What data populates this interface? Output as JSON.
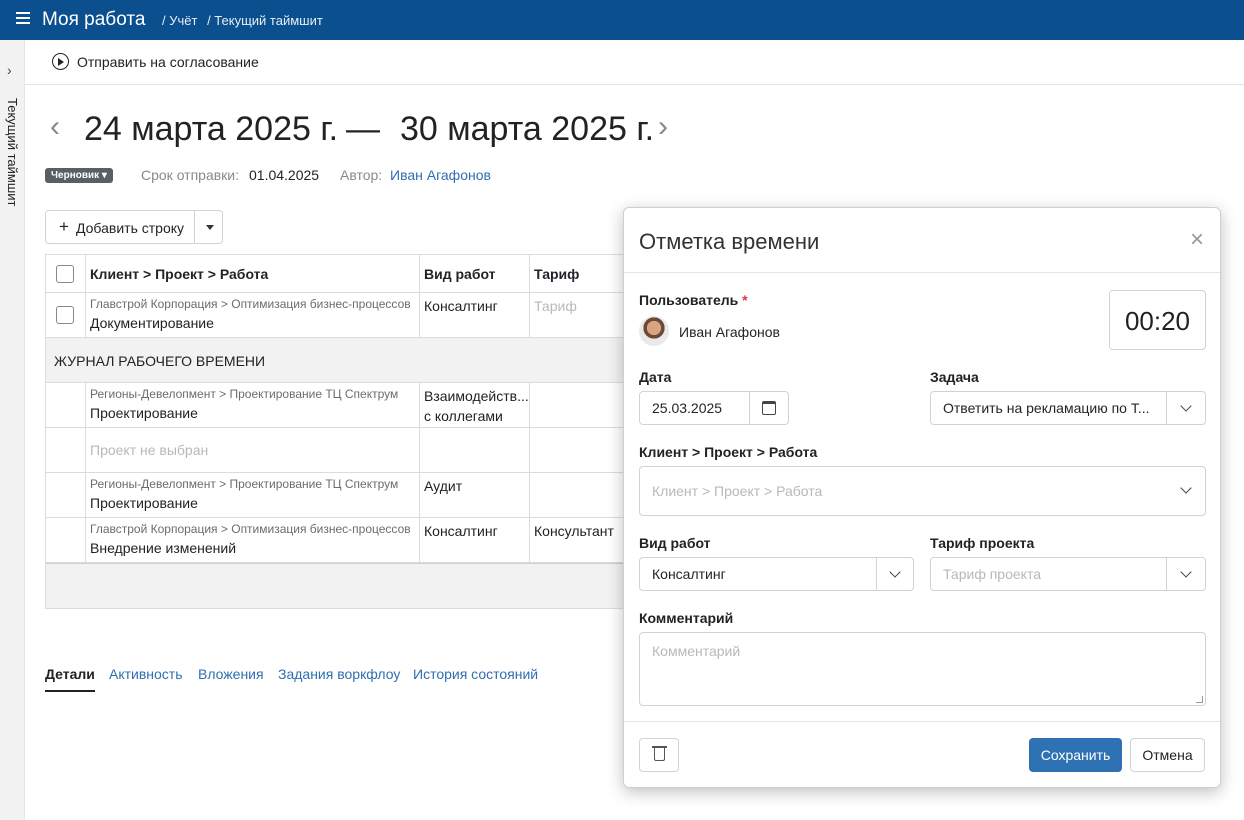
{
  "header": {
    "app_title": "Моя работа",
    "breadcrumbs": [
      "/ Учёт",
      "/ Текущий таймшит"
    ]
  },
  "side_rail": {
    "label": "Текущий таймшит"
  },
  "toolbar": {
    "send_label": "Отправить на согласование"
  },
  "period": {
    "start": "24 марта 2025 г.",
    "dash": "—",
    "end": "30 марта 2025 г."
  },
  "meta": {
    "status": "Черновик",
    "deadline_label": "Срок отправки:",
    "deadline_value": "01.04.2025",
    "author_label": "Автор:",
    "author_value": "Иван Агафонов"
  },
  "add_row": {
    "label": "Добавить строку"
  },
  "grid": {
    "columns": [
      "Клиент > Проект > Работа",
      "Вид работ",
      "Тариф"
    ],
    "row1": {
      "path": "Главстрой Корпорация > Оптимизация бизнес-процессов",
      "task": "Документирование",
      "work_type": "Консалтинг",
      "tariff_placeholder": "Тариф"
    },
    "section": "ЖУРНАЛ РАБОЧЕГО ВРЕМЕНИ",
    "row2": {
      "path": "Регионы-Девелопмент > Проектирование ТЦ Спектрум",
      "task": "Проектирование",
      "work_type_1": "Взаимодейств...",
      "work_type_2": "с коллегами"
    },
    "row3": {
      "placeholder": "Проект не выбран"
    },
    "row4": {
      "path": "Регионы-Девелопмент > Проектирование ТЦ Спектрум",
      "task": "Проектирование",
      "work_type": "Аудит"
    },
    "row5": {
      "path": "Главстрой Корпорация > Оптимизация бизнес-процессов",
      "task": "Внедрение изменений",
      "work_type": "Консалтинг",
      "tariff": "Консультант"
    }
  },
  "tabs": [
    "Детали",
    "Активность",
    "Вложения",
    "Задания воркфлоу",
    "История состояний"
  ],
  "modal": {
    "title": "Отметка времени",
    "close": "×",
    "user_label": "Пользователь",
    "required_mark": "*",
    "user_name": "Иван Агафонов",
    "time": "00:20",
    "date_label": "Дата",
    "date_value": "25.03.2025",
    "task_label": "Задача",
    "task_value": "Ответить на рекламацию по Т...",
    "cpw_label": "Клиент > Проект > Работа",
    "cpw_placeholder": "Клиент > Проект > Работа",
    "work_type_label": "Вид работ",
    "work_type_value": "Консалтинг",
    "tariff_label": "Тариф проекта",
    "tariff_placeholder": "Тариф проекта",
    "comment_label": "Комментарий",
    "comment_placeholder": "Комментарий",
    "save": "Сохранить",
    "cancel": "Отмена"
  }
}
